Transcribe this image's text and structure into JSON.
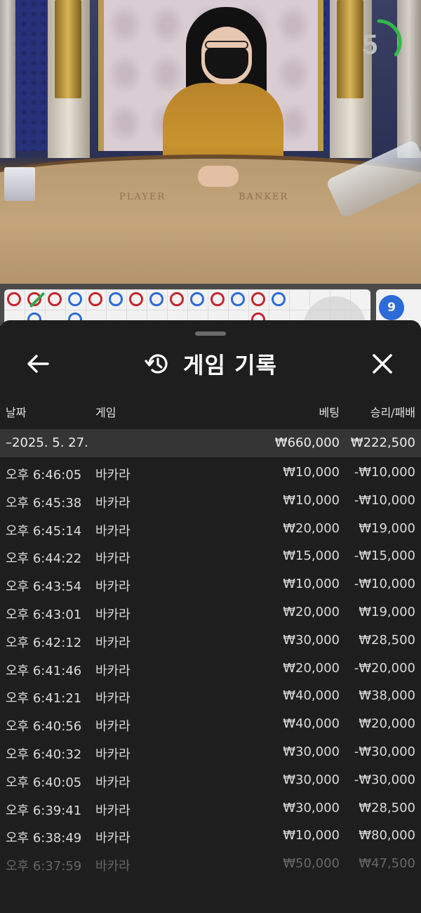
{
  "timer": {
    "seconds": "5",
    "remaining_fraction": 0.35,
    "color": "#2fb84a"
  },
  "table": {
    "player_label": "PLAYER",
    "banker_label": "BANKER"
  },
  "roadmap": {
    "side_badge": "9",
    "beads": [
      {
        "col": 0,
        "row": 0,
        "result": "banker"
      },
      {
        "col": 1,
        "row": 0,
        "result": "banker"
      },
      {
        "col": 1,
        "row": 1,
        "result": "player"
      },
      {
        "col": 2,
        "row": 0,
        "result": "banker"
      },
      {
        "col": 3,
        "row": 0,
        "result": "player"
      },
      {
        "col": 3,
        "row": 1,
        "result": "player"
      },
      {
        "col": 4,
        "row": 0,
        "result": "banker"
      },
      {
        "col": 5,
        "row": 0,
        "result": "player"
      },
      {
        "col": 6,
        "row": 0,
        "result": "banker"
      },
      {
        "col": 7,
        "row": 0,
        "result": "player"
      },
      {
        "col": 8,
        "row": 0,
        "result": "banker"
      },
      {
        "col": 9,
        "row": 0,
        "result": "player"
      },
      {
        "col": 10,
        "row": 0,
        "result": "banker"
      },
      {
        "col": 11,
        "row": 0,
        "result": "player"
      },
      {
        "col": 12,
        "row": 0,
        "result": "banker"
      },
      {
        "col": 12,
        "row": 1,
        "result": "banker"
      },
      {
        "col": 13,
        "row": 0,
        "result": "player"
      }
    ],
    "colors": {
      "banker": "#c4262e",
      "player": "#2d6bd6",
      "tie": "#2fa84a"
    }
  },
  "sheet": {
    "title": "게임 기록",
    "columns": {
      "date": "날짜",
      "game": "게임",
      "bet": "베팅",
      "win_loss": "승리/패배"
    },
    "summary": {
      "date": "–2025. 5. 27.",
      "bet": "₩660,000",
      "win_loss": "₩222,500"
    },
    "rows": [
      {
        "time": "오후 6:46:05",
        "game": "바카라",
        "bet": "₩10,000",
        "result": "-₩10,000"
      },
      {
        "time": "오후 6:45:38",
        "game": "바카라",
        "bet": "₩10,000",
        "result": "-₩10,000"
      },
      {
        "time": "오후 6:45:14",
        "game": "바카라",
        "bet": "₩20,000",
        "result": "₩19,000"
      },
      {
        "time": "오후 6:44:22",
        "game": "바카라",
        "bet": "₩15,000",
        "result": "-₩15,000"
      },
      {
        "time": "오후 6:43:54",
        "game": "바카라",
        "bet": "₩10,000",
        "result": "-₩10,000"
      },
      {
        "time": "오후 6:43:01",
        "game": "바카라",
        "bet": "₩20,000",
        "result": "₩19,000"
      },
      {
        "time": "오후 6:42:12",
        "game": "바카라",
        "bet": "₩30,000",
        "result": "₩28,500"
      },
      {
        "time": "오후 6:41:46",
        "game": "바카라",
        "bet": "₩20,000",
        "result": "-₩20,000"
      },
      {
        "time": "오후 6:41:21",
        "game": "바카라",
        "bet": "₩40,000",
        "result": "₩38,000"
      },
      {
        "time": "오후 6:40:56",
        "game": "바카라",
        "bet": "₩40,000",
        "result": "₩20,000"
      },
      {
        "time": "오후 6:40:32",
        "game": "바카라",
        "bet": "₩30,000",
        "result": "-₩30,000"
      },
      {
        "time": "오후 6:40:05",
        "game": "바카라",
        "bet": "₩30,000",
        "result": "-₩30,000"
      },
      {
        "time": "오후 6:39:41",
        "game": "바카라",
        "bet": "₩30,000",
        "result": "₩28,500"
      },
      {
        "time": "오후 6:38:49",
        "game": "바카라",
        "bet": "₩10,000",
        "result": "₩80,000"
      },
      {
        "time": "오후 6:37:59",
        "game": "바카라",
        "bet": "₩50,000",
        "result": "₩47,500"
      }
    ]
  },
  "icons": {
    "back": "arrow-left-icon",
    "history": "history-icon",
    "close": "close-icon"
  }
}
